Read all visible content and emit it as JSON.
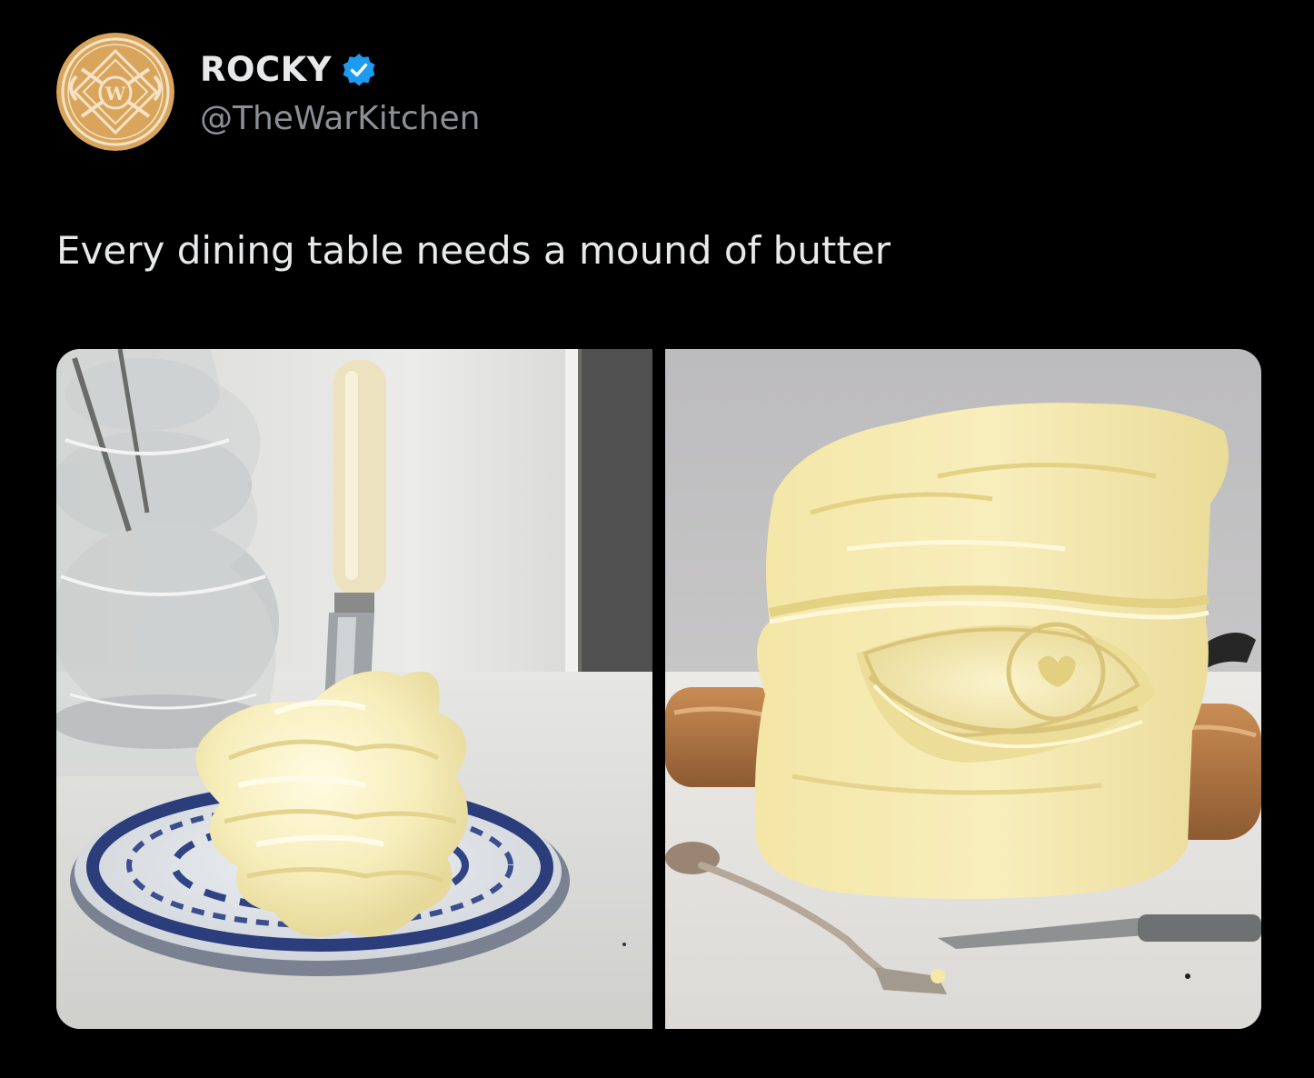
{
  "tweet": {
    "author": {
      "display_name": "ROCKY",
      "handle": "@TheWarKitchen",
      "verified": true,
      "avatar_icon": "war-kitchen-logo-icon",
      "avatar_letter": "W",
      "verified_icon": "verified-badge-icon"
    },
    "text": "Every dining table needs a mound of butter",
    "media": [
      {
        "icon": "butter-mound-with-knife-photo"
      },
      {
        "icon": "butter-eye-sculpture-photo"
      }
    ]
  },
  "colors": {
    "background": "#000000",
    "text_primary": "#e7e9ea",
    "text_secondary": "#8b9096",
    "verified_blue": "#1d9bf0",
    "avatar_gold": "#d9a55c"
  }
}
